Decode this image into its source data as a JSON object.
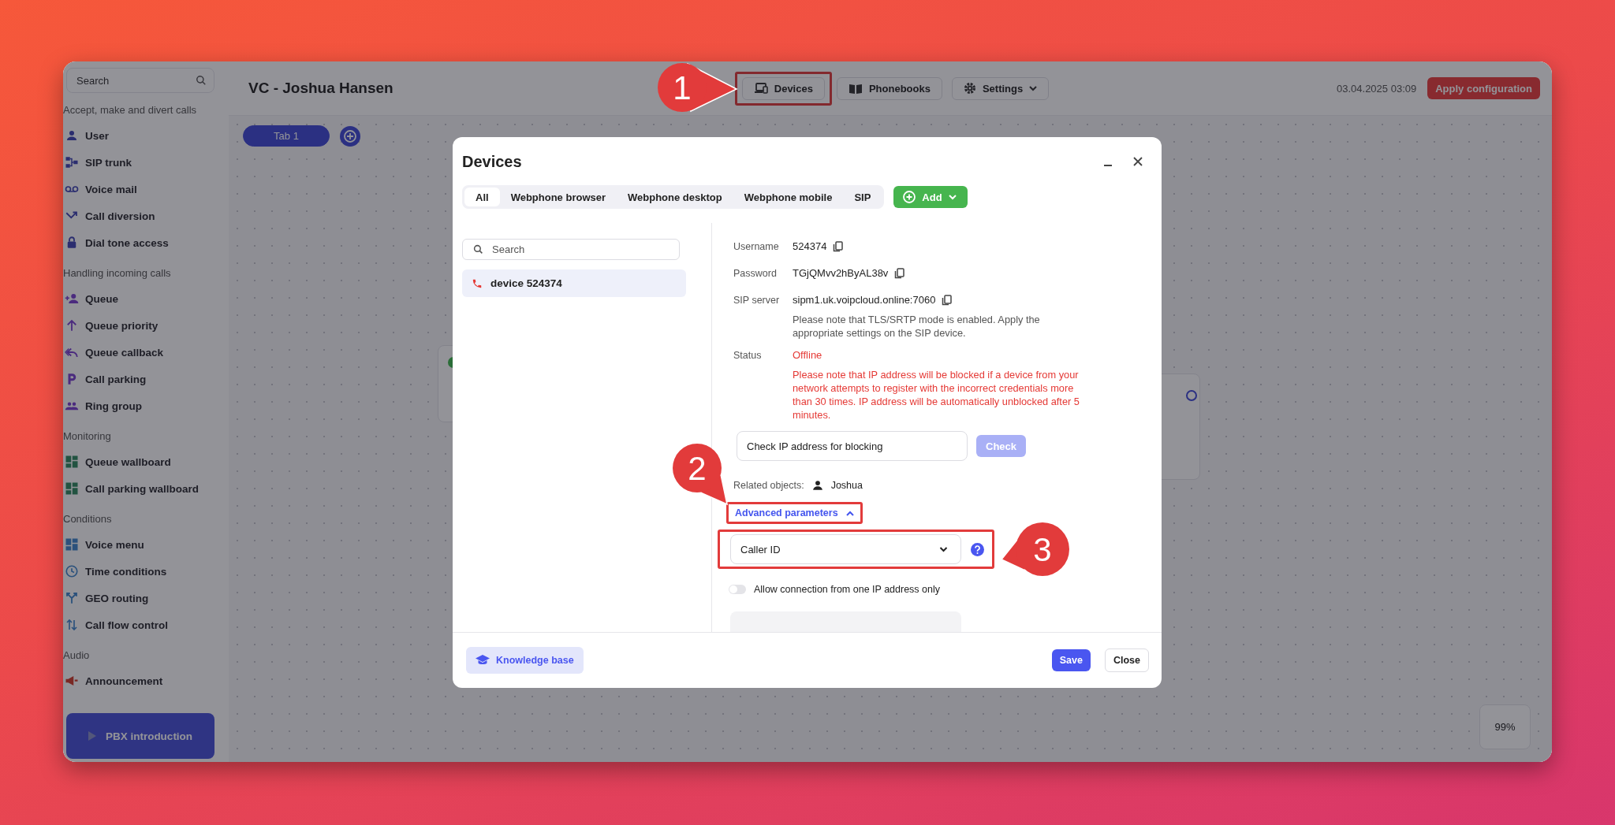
{
  "sidebar": {
    "search": {
      "placeholder": "Search"
    },
    "groups": [
      {
        "title": "Accept, make and divert calls",
        "items": [
          {
            "label": "User"
          },
          {
            "label": "SIP trunk"
          },
          {
            "label": "Voice mail"
          },
          {
            "label": "Call diversion"
          },
          {
            "label": "Dial tone access"
          }
        ]
      },
      {
        "title": "Handling incoming calls",
        "items": [
          {
            "label": "Queue"
          },
          {
            "label": "Queue priority"
          },
          {
            "label": "Queue callback"
          },
          {
            "label": "Call parking"
          },
          {
            "label": "Ring group"
          }
        ]
      },
      {
        "title": "Monitoring",
        "items": [
          {
            "label": "Queue wallboard"
          },
          {
            "label": "Call parking wallboard"
          }
        ]
      },
      {
        "title": "Conditions",
        "items": [
          {
            "label": "Voice menu"
          },
          {
            "label": "Time conditions"
          },
          {
            "label": "GEO routing"
          },
          {
            "label": "Call flow control"
          }
        ]
      },
      {
        "title": "Audio",
        "items": [
          {
            "label": "Announcement"
          }
        ]
      }
    ],
    "intro_button": "PBX introduction"
  },
  "header": {
    "title": "VC - Joshua Hansen",
    "nav": [
      {
        "label": "Devices",
        "dropdown": false
      },
      {
        "label": "Phonebooks",
        "dropdown": false
      },
      {
        "label": "Settings",
        "dropdown": true
      }
    ],
    "datetime": "03.04.2025 03:09",
    "apply_button": "Apply configuration"
  },
  "canvas": {
    "tabs": [
      {
        "label": "Tab 1",
        "selected": true
      }
    ],
    "zoom": "99%"
  },
  "dialog": {
    "title": "Devices",
    "filters": [
      {
        "label": "All",
        "selected": true
      },
      {
        "label": "Webphone browser",
        "selected": false
      },
      {
        "label": "Webphone desktop",
        "selected": false
      },
      {
        "label": "Webphone mobile",
        "selected": false
      },
      {
        "label": "SIP",
        "selected": false
      }
    ],
    "add_button": "Add",
    "search": {
      "placeholder": "Search"
    },
    "devices": [
      {
        "name": "device 524374",
        "selected": true
      }
    ],
    "details": [
      {
        "kind": "copy",
        "label": "Username",
        "value": "524374"
      },
      {
        "kind": "copy",
        "label": "Password",
        "value": "TGjQMvv2hByAL38v"
      },
      {
        "kind": "copy",
        "label": "SIP server",
        "value": "sipm1.uk.voipcloud.online:7060",
        "note": "Please note that TLS/SRTP mode is enabled. Apply the appropriate settings on the SIP device."
      },
      {
        "kind": "status",
        "label": "Status",
        "value": "Offline",
        "note": "Please note that IP address will be blocked if a device from your network attempts to register with the incorrect credentials more than 30 times. IP address will be automatically unblocked after 5 minutes."
      }
    ],
    "ip_check": {
      "placeholder": "Check IP address for blocking",
      "button": "Check",
      "disabled": true
    },
    "related": {
      "label": "Related objects:",
      "name": "Joshua"
    },
    "advanced": {
      "label": "Advanced parameters",
      "expanded": true
    },
    "caller_id": {
      "value": "Caller ID"
    },
    "ip_only": {
      "label": "Allow connection from one IP address only",
      "on": false
    },
    "footer": {
      "knowledge_base": "Knowledge base",
      "save": "Save",
      "close": "Close"
    }
  },
  "callouts": [
    {
      "number": "1"
    },
    {
      "number": "2"
    },
    {
      "number": "3"
    }
  ]
}
